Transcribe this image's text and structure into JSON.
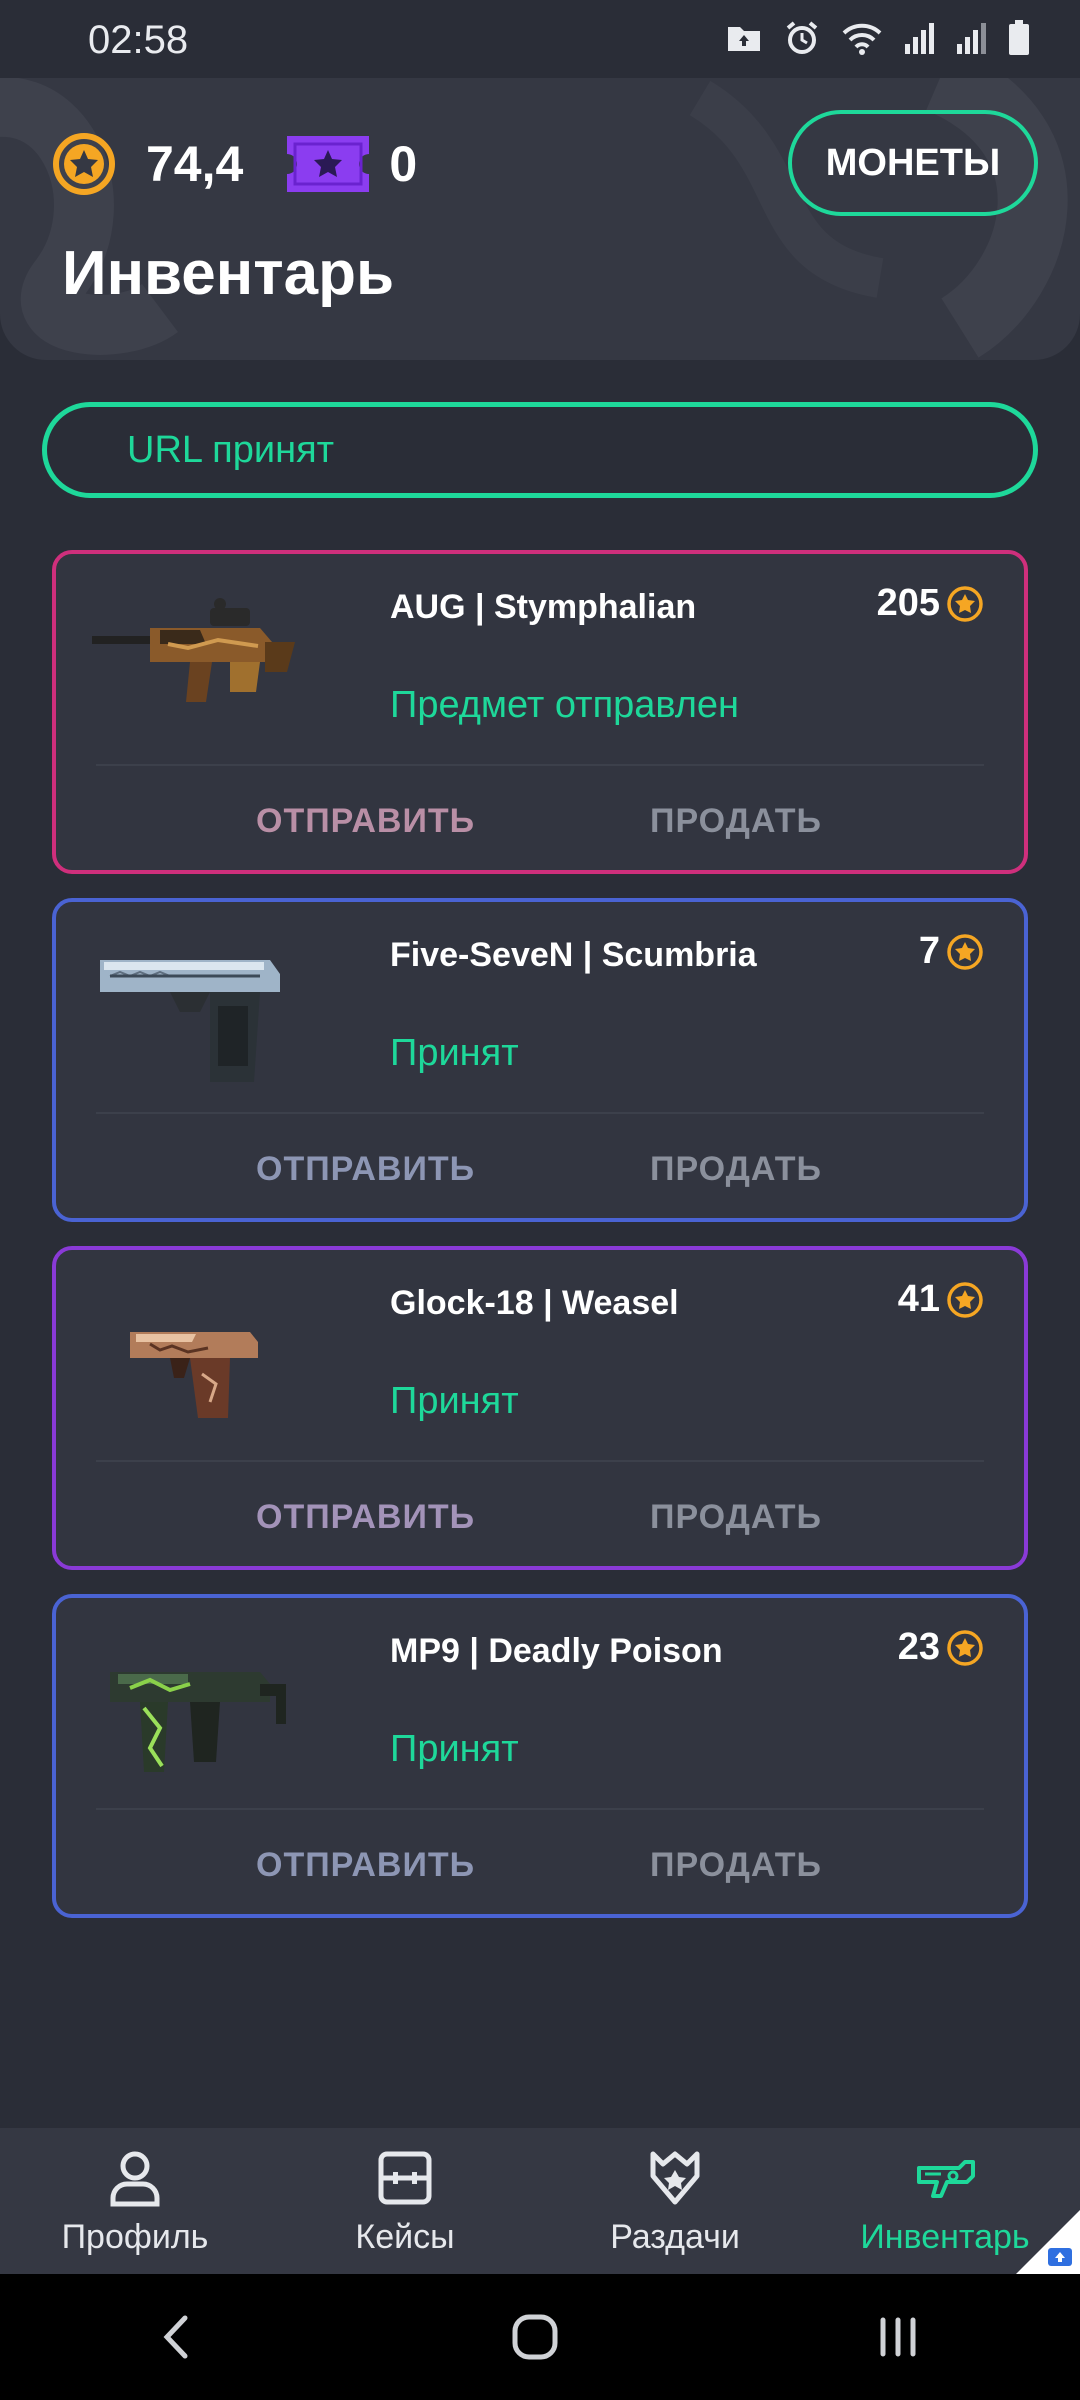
{
  "status_bar": {
    "time": "02:58"
  },
  "header": {
    "coin_balance": "74,4",
    "ticket_balance": "0",
    "coins_button_label": "МОНЕТЫ",
    "title": "Инвентарь"
  },
  "url_status": "URL принят",
  "items": [
    {
      "name": "AUG | Stymphalian",
      "price": "205",
      "status": "Предмет отправлен",
      "send_label": "ОТПРАВИТЬ",
      "sell_label": "ПРОДАТЬ",
      "border_color": "#cf2f7c",
      "send_color": "#b98fa6"
    },
    {
      "name": "Five-SeveN | Scumbria",
      "price": "7",
      "status": "Принят",
      "send_label": "ОТПРАВИТЬ",
      "sell_label": "ПРОДАТЬ",
      "border_color": "#4a63d3",
      "send_color": "#8d96b4"
    },
    {
      "name": "Glock-18 | Weasel",
      "price": "41",
      "status": "Принят",
      "send_label": "ОТПРАВИТЬ",
      "sell_label": "ПРОДАТЬ",
      "border_color": "#8a3ad7",
      "send_color": "#a393b9"
    },
    {
      "name": "MP9 | Deadly Poison",
      "price": "23",
      "status": "Принят",
      "send_label": "ОТПРАВИТЬ",
      "sell_label": "ПРОДАТЬ",
      "border_color": "#4a63d3",
      "send_color": "#8d96b4"
    }
  ],
  "bottom_nav": [
    {
      "label": "Профиль",
      "icon": "profile-icon"
    },
    {
      "label": "Кейсы",
      "icon": "cases-icon"
    },
    {
      "label": "Раздачи",
      "icon": "giveaways-icon"
    },
    {
      "label": "Инвентарь",
      "icon": "inventory-icon",
      "active": true
    }
  ],
  "colors": {
    "accent": "#1ed89a",
    "coin": "#f5a623",
    "ticket": "#8b3df0",
    "background": "#2a2d37"
  }
}
